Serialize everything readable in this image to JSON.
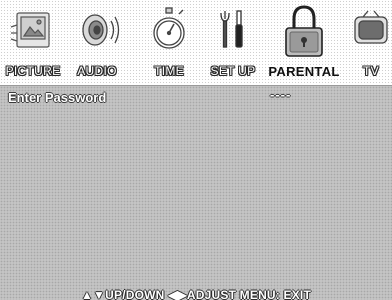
{
  "menu": {
    "items": [
      {
        "label": "PICTURE",
        "icon": "picture-icon",
        "active": false
      },
      {
        "label": "AUDIO",
        "icon": "speaker-icon",
        "active": false
      },
      {
        "label": "TIME",
        "icon": "stopwatch-icon",
        "active": false
      },
      {
        "label": "SET UP",
        "icon": "tools-icon",
        "active": false
      },
      {
        "label": "PARENTAL",
        "icon": "padlock-icon",
        "active": true
      },
      {
        "label": "TV",
        "icon": "tv-icon",
        "active": false
      }
    ]
  },
  "parental": {
    "prompt": "Enter Password",
    "password_value": "----"
  },
  "footer": {
    "hint": "▲▼UP/DOWN  ◀▶ADJUST  MENU: EXIT"
  },
  "colors": {
    "content_background": "#c4c4c4",
    "menu_background": "#ffffff",
    "active_label": "#111111"
  }
}
